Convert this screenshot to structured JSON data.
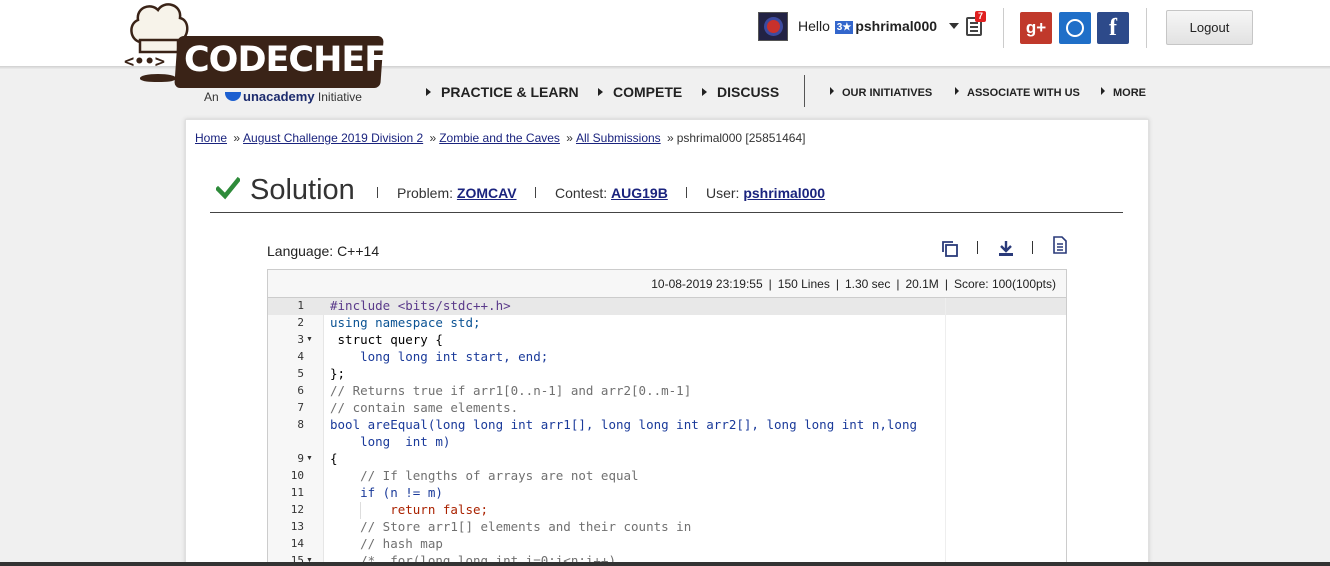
{
  "brand": {
    "logo_text": "CODECHEF",
    "logo_face": "<••>",
    "tagline_prefix": "An",
    "tagline_brand": "unacademy",
    "tagline_suffix": "Initiative"
  },
  "user": {
    "greeting": "Hello",
    "rating_badge": "3★",
    "username": "pshrimal000",
    "notifications": "7"
  },
  "social": {
    "google": "g+",
    "github": "",
    "facebook": "f"
  },
  "header": {
    "logout_label": "Logout"
  },
  "nav": {
    "primary": [
      "PRACTICE & LEARN",
      "COMPETE",
      "DISCUSS"
    ],
    "secondary": [
      "OUR INITIATIVES",
      "ASSOCIATE WITH US",
      "MORE"
    ]
  },
  "breadcrumb": {
    "items": [
      "Home",
      "August Challenge 2019 Division 2",
      "Zombie and the Caves",
      "All Submissions"
    ],
    "separator": "»",
    "current": "pshrimal000 [25851464]"
  },
  "solution": {
    "title": "Solution",
    "problem_label": "Problem:",
    "problem": "ZOMCAV",
    "contest_label": "Contest:",
    "contest": "AUG19B",
    "user_label": "User:",
    "user": "pshrimal000"
  },
  "code_meta": {
    "language": "Language: C++14",
    "date": "10-08-2019 23:19:55",
    "lines": "150 Lines",
    "time": "1.30 sec",
    "memory": "20.1M",
    "score": "Score: 100(100pts)"
  },
  "code": {
    "line_numbers": [
      "1",
      "2",
      "3",
      "4",
      "5",
      "6",
      "7",
      "8",
      "",
      "9",
      "10",
      "11",
      "12",
      "13",
      "14",
      "15"
    ],
    "lines": [
      "#include <bits/stdc++.h>",
      "using namespace std;",
      " struct query {",
      "    long long int start, end;",
      "};",
      "// Returns true if arr1[0..n-1] and arr2[0..m-1]",
      "// contain same elements.",
      "bool areEqual(long long int arr1[], long long int arr2[], long long int n,long",
      "    long  int m)",
      "{",
      "    // If lengths of arrays are not equal",
      "    if (n != m)",
      "        return false;",
      "    // Store arr1[] elements and their counts in",
      "    // hash map",
      "    /*  for(long long int i=0;i<n;i++)"
    ]
  },
  "colors": {
    "accent_link": "#1a237e",
    "check_green": "#2e8b3a",
    "logo_brown": "#3a2317"
  }
}
